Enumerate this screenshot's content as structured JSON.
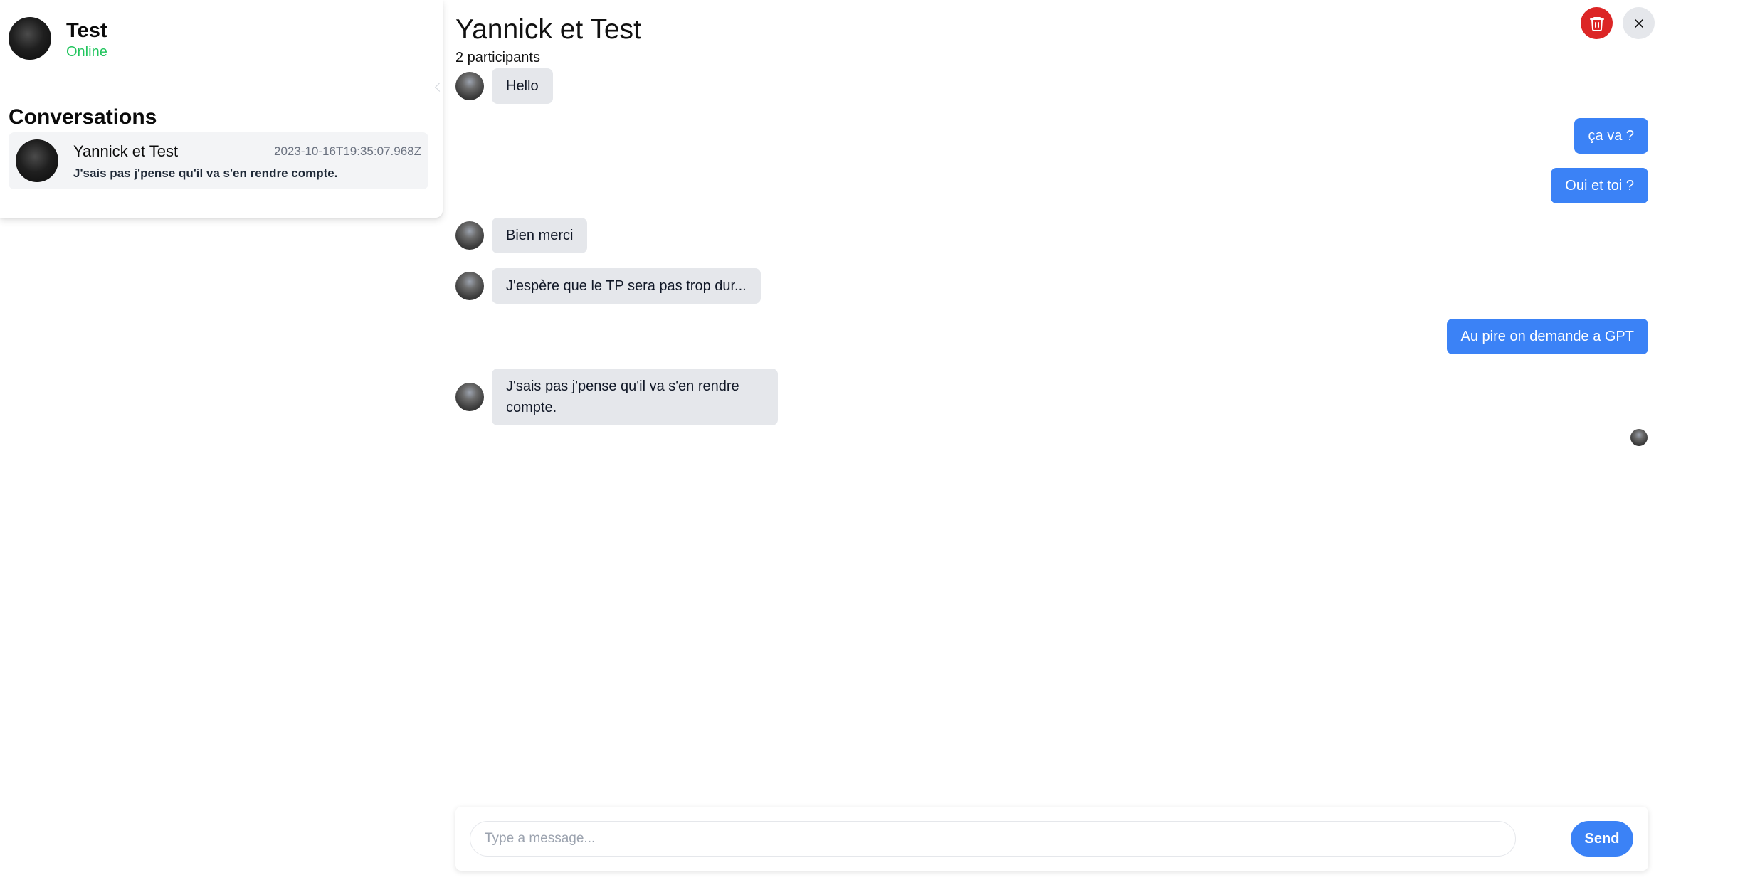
{
  "user": {
    "name": "Test",
    "status": "Online",
    "status_color": "#22c55e"
  },
  "sidebar": {
    "heading": "Conversations",
    "conversations": [
      {
        "name": "Yannick et Test",
        "date": "2023-10-16T19:35:07.968Z",
        "preview": "J'sais pas j'pense qu'il va s'en rendre compte."
      }
    ]
  },
  "chat": {
    "title": "Yannick et Test",
    "participants": "2 participants",
    "messages": [
      {
        "direction": "incoming",
        "text": "Hello"
      },
      {
        "direction": "outgoing",
        "text": "ça va ?"
      },
      {
        "direction": "outgoing",
        "text": "Oui et toi ?"
      },
      {
        "direction": "incoming",
        "text": "Bien merci"
      },
      {
        "direction": "incoming",
        "text": "J'espère que le TP sera pas trop dur..."
      },
      {
        "direction": "outgoing",
        "text": "Au pire on demande a GPT"
      },
      {
        "direction": "incoming",
        "text": "J'sais pas j'pense qu'il va s'en rendre compte."
      }
    ],
    "actions": {
      "delete_icon": "trash-icon",
      "close_icon": "close-icon"
    }
  },
  "composer": {
    "placeholder": "Type a message...",
    "value": "",
    "send_label": "Send"
  },
  "colors": {
    "accent": "#3b82f6",
    "danger": "#dc2626",
    "incoming_bubble": "#e5e7eb",
    "close_button": "#e5e7eb"
  }
}
